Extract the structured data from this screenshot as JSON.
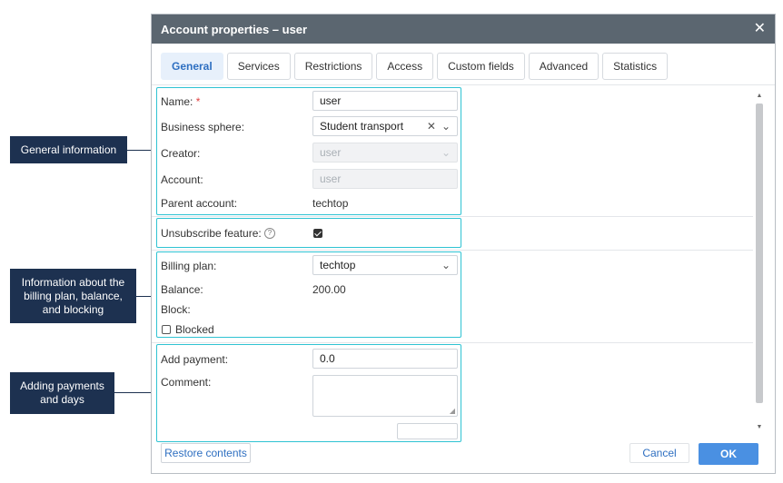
{
  "dialog": {
    "title": "Account properties – user",
    "close_glyph": "✕"
  },
  "tabs": [
    {
      "label": "General",
      "active": true
    },
    {
      "label": "Services"
    },
    {
      "label": "Restrictions"
    },
    {
      "label": "Access"
    },
    {
      "label": "Custom fields"
    },
    {
      "label": "Advanced"
    },
    {
      "label": "Statistics"
    }
  ],
  "general": {
    "name_label": "Name:",
    "required_mark": "*",
    "name_value": "user",
    "business_sphere_label": "Business sphere:",
    "business_sphere_value": "Student transport",
    "creator_label": "Creator:",
    "creator_value": "user",
    "account_label": "Account:",
    "account_value": "user",
    "parent_account_label": "Parent account:",
    "parent_account_value": "techtop"
  },
  "unsubscribe": {
    "label": "Unsubscribe feature:",
    "help_glyph": "?",
    "checked": true
  },
  "billing": {
    "plan_label": "Billing plan:",
    "plan_value": "techtop",
    "balance_label": "Balance:",
    "balance_value": "200.00",
    "block_label": "Block:",
    "blocked_label": "Blocked",
    "blocked_checked": false
  },
  "payment": {
    "add_payment_label": "Add payment:",
    "add_payment_value": "0.0",
    "comment_label": "Comment:",
    "comment_value": ""
  },
  "footer": {
    "restore_label": "Restore contents",
    "cancel_label": "Cancel",
    "ok_label": "OK"
  },
  "callouts": {
    "general_info": "General information",
    "billing_info": "Information about the billing plan, balance, and blocking",
    "payments": "Adding payments and days"
  },
  "icons": {
    "clear": "clear-icon",
    "chevron": "chevron-down-icon",
    "help": "help-icon",
    "close": "close-icon"
  },
  "colors": {
    "titlebar": "#5b6670",
    "accent": "#4a90e2",
    "highlight": "#2fc3d3",
    "callout": "#1d3150"
  }
}
